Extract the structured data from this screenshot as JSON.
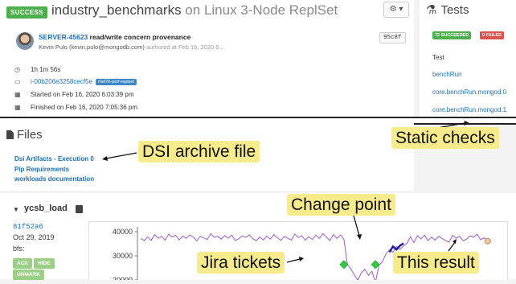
{
  "task": {
    "status_badge": "SUCCESS",
    "name": "industry_benchmarks",
    "on_text": " on ",
    "variant": "Linux 3-Node ReplSet",
    "gear_label": "⚙ ▾",
    "commit": {
      "id": "SERVER-45623",
      "message": " read/write concern provenance",
      "author": "Kevin Pulo (kevin.pulo@mongodb.com)",
      "authored": " authored at Feb 16, 2020 6...",
      "hash": "95c8f"
    },
    "duration": "1h 1m 56s",
    "host": "i-00b206e3258cecf5e",
    "distro": "rhel70-perf-replset",
    "started": "Started on Feb 16, 2020 6:03:39 pm",
    "finished": "Finished on Feb 16, 2020 7:05:36 pm"
  },
  "tests": {
    "title": "Tests",
    "succeeded": "72 SUCCEEDED",
    "failed": "0 FAILED",
    "header": "Test",
    "items": [
      "benchRun",
      "core.benchRun.mongod.0",
      "core.benchRun.mongod.1"
    ]
  },
  "files": {
    "title": "Files",
    "items": [
      "Dsi Artifacts - Execution 0",
      "Pip Requirements",
      "workloads documentation"
    ]
  },
  "perf": {
    "name": "ycsb_load",
    "hash": "81f52a6",
    "date": "Oct 29, 2019",
    "bfs": "bfs:",
    "ack": "ACK",
    "hide": "HIDE",
    "unmark": "UNMARK"
  },
  "chart_data": {
    "type": "line",
    "y_ticks": [
      "40000",
      "30000",
      "20000"
    ],
    "ylim": [
      15000,
      42000
    ],
    "series": [
      {
        "color": "#9b59d0",
        "values": [
          37200,
          36300,
          37900,
          36400,
          38800,
          37300,
          38100,
          36500,
          39000,
          37800,
          38500,
          36600,
          38200,
          37200,
          38600,
          37800,
          36200,
          38100,
          37400,
          36800,
          39200,
          37600,
          38100,
          36900,
          38400,
          37300,
          38600,
          36400,
          37100,
          38300,
          37600,
          38700,
          37100,
          36300,
          37800,
          36600,
          38200,
          36900,
          38800,
          37600,
          36400,
          38100,
          37300,
          36500,
          39000,
          37600,
          38300,
          36500,
          37900,
          36800,
          38600,
          37200,
          39200,
          37800,
          36300,
          38800,
          37200,
          38600,
          36900,
          26400,
          24600,
          22000,
          19900,
          23100,
          24400,
          21900,
          23600,
          19000,
          26100,
          27600,
          30800,
          32500,
          31500,
          33900,
          32600,
          34200,
          35200,
          37900,
          35500,
          38400,
          37000,
          38600,
          36300,
          37800,
          36500,
          38100,
          37200,
          36400,
          35600,
          38500,
          37300,
          38100,
          36300,
          36900,
          38300,
          37700,
          39000,
          36700,
          37500,
          36100,
          36000
        ]
      }
    ],
    "change_point_segment": [
      31500,
      33900,
      32600,
      34200,
      35200
    ],
    "jira_ticket_points": [
      {
        "index": 58,
        "y": 26400
      },
      {
        "index": 67,
        "y": 26400
      }
    ],
    "this_result_index": 99
  },
  "callouts": {
    "static_checks": "Static checks",
    "dsi_archive": "DSI archive file",
    "change_point": "Change point",
    "jira_tickets": "Jira tickets",
    "this_result": "This result"
  },
  "colors": {
    "success": "#4db04d",
    "failed": "#d9534f",
    "link": "#1b6fb6",
    "callout": "#f7eb8c",
    "series": "#9b59d0",
    "change_point": "#1a1a9c",
    "jira": "#2ecc40"
  }
}
